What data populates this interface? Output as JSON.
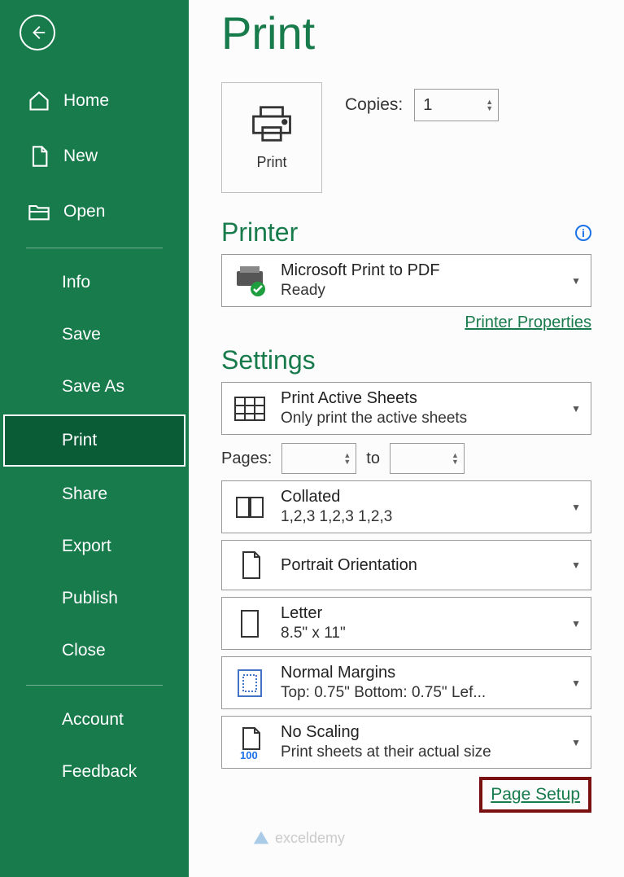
{
  "sidebar": {
    "items": [
      {
        "label": "Home",
        "icon": "home"
      },
      {
        "label": "New",
        "icon": "new"
      },
      {
        "label": "Open",
        "icon": "open"
      }
    ],
    "secondary": [
      {
        "label": "Info"
      },
      {
        "label": "Save"
      },
      {
        "label": "Save As"
      },
      {
        "label": "Print",
        "selected": true
      },
      {
        "label": "Share"
      },
      {
        "label": "Export"
      },
      {
        "label": "Publish"
      },
      {
        "label": "Close"
      }
    ],
    "footer": [
      {
        "label": "Account"
      },
      {
        "label": "Feedback"
      }
    ]
  },
  "page": {
    "title": "Print",
    "print_button": "Print",
    "copies_label": "Copies:",
    "copies_value": "1"
  },
  "printer": {
    "heading": "Printer",
    "name": "Microsoft Print to PDF",
    "status": "Ready",
    "properties_link": "Printer Properties"
  },
  "settings": {
    "heading": "Settings",
    "pages_label": "Pages:",
    "pages_to": "to",
    "items": [
      {
        "title": "Print Active Sheets",
        "sub": "Only print the active sheets"
      },
      {
        "title": "Collated",
        "sub": "1,2,3    1,2,3    1,2,3"
      },
      {
        "title": "Portrait Orientation",
        "sub": ""
      },
      {
        "title": "Letter",
        "sub": "8.5\" x 11\""
      },
      {
        "title": "Normal Margins",
        "sub": "Top: 0.75\" Bottom: 0.75\" Lef..."
      },
      {
        "title": "No Scaling",
        "sub": "Print sheets at their actual size"
      }
    ],
    "page_setup": "Page Setup"
  },
  "watermark": "exceldemy"
}
